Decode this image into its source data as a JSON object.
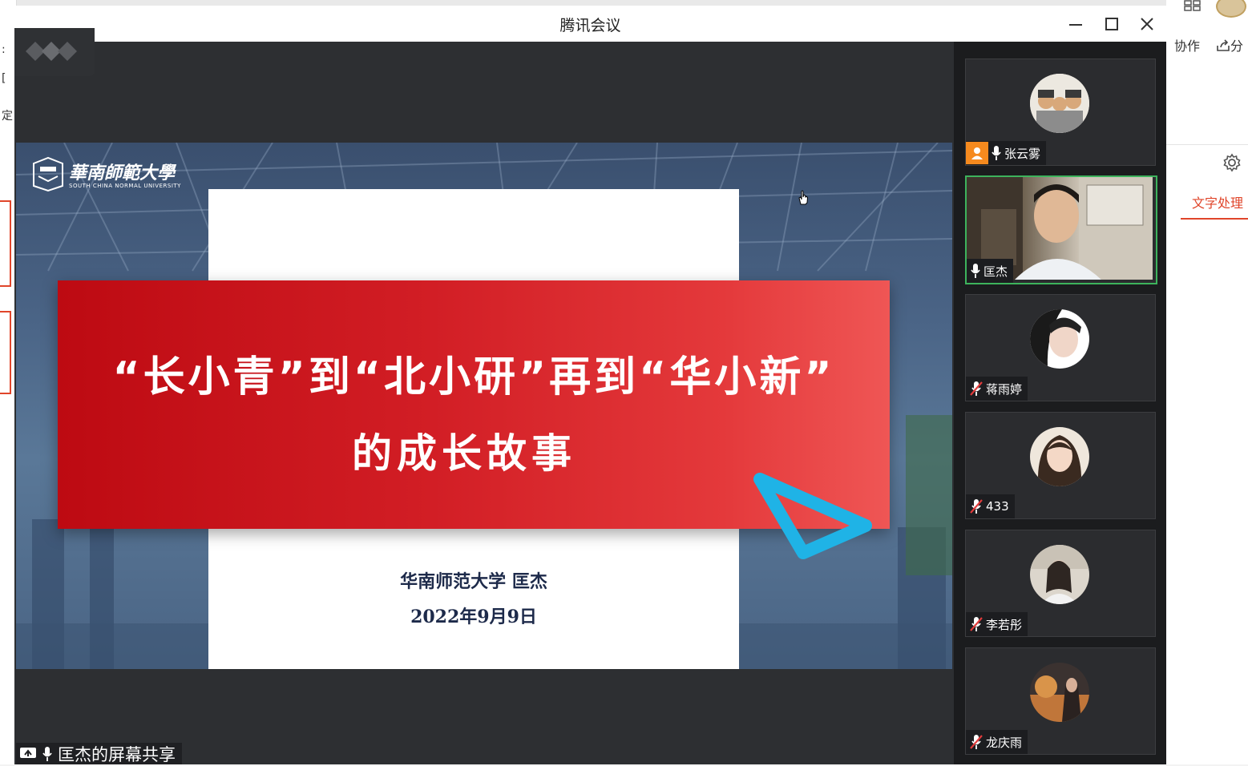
{
  "window": {
    "title": "腾讯会议",
    "controls": [
      "minimize",
      "maximize",
      "close"
    ]
  },
  "background_app": {
    "collab_label": "协作",
    "share_label_partial": "分",
    "panel_tab_label": "文字处理",
    "left_glyphs": [
      ":",
      "[",
      "定"
    ],
    "accent_color": "#e0452a"
  },
  "slide": {
    "university_name": "華南師範大學",
    "university_sub": "SOUTH CHINA NORMAL UNIVERSITY",
    "title_line1": "“长小青”到“北小研”再到“华小新”",
    "title_line2": "的成长故事",
    "author": "华南师范大学 匡杰",
    "date": "2022年9月9日",
    "banner_color": "#d21e25"
  },
  "share": {
    "label": "匡杰的屏幕共享"
  },
  "participants": [
    {
      "name": "张云雾",
      "mic": "on",
      "host": true,
      "avatar": "group-photo-avatar"
    },
    {
      "name": "匡杰",
      "mic": "on",
      "host": false,
      "avatar": "live-video",
      "speaking": true
    },
    {
      "name": "蒋雨婷",
      "mic": "muted",
      "host": false,
      "avatar": "portrait-avatar"
    },
    {
      "name": "433",
      "mic": "muted",
      "host": false,
      "avatar": "portrait-avatar"
    },
    {
      "name": "李若彤",
      "mic": "muted",
      "host": false,
      "avatar": "portrait-avatar"
    },
    {
      "name": "龙庆雨",
      "mic": "muted",
      "host": false,
      "avatar": "landscape-avatar"
    }
  ],
  "colors": {
    "active_speaker_border": "#3db35c",
    "host_badge": "#f68a1e",
    "muted_icon": "#e23b3b"
  }
}
